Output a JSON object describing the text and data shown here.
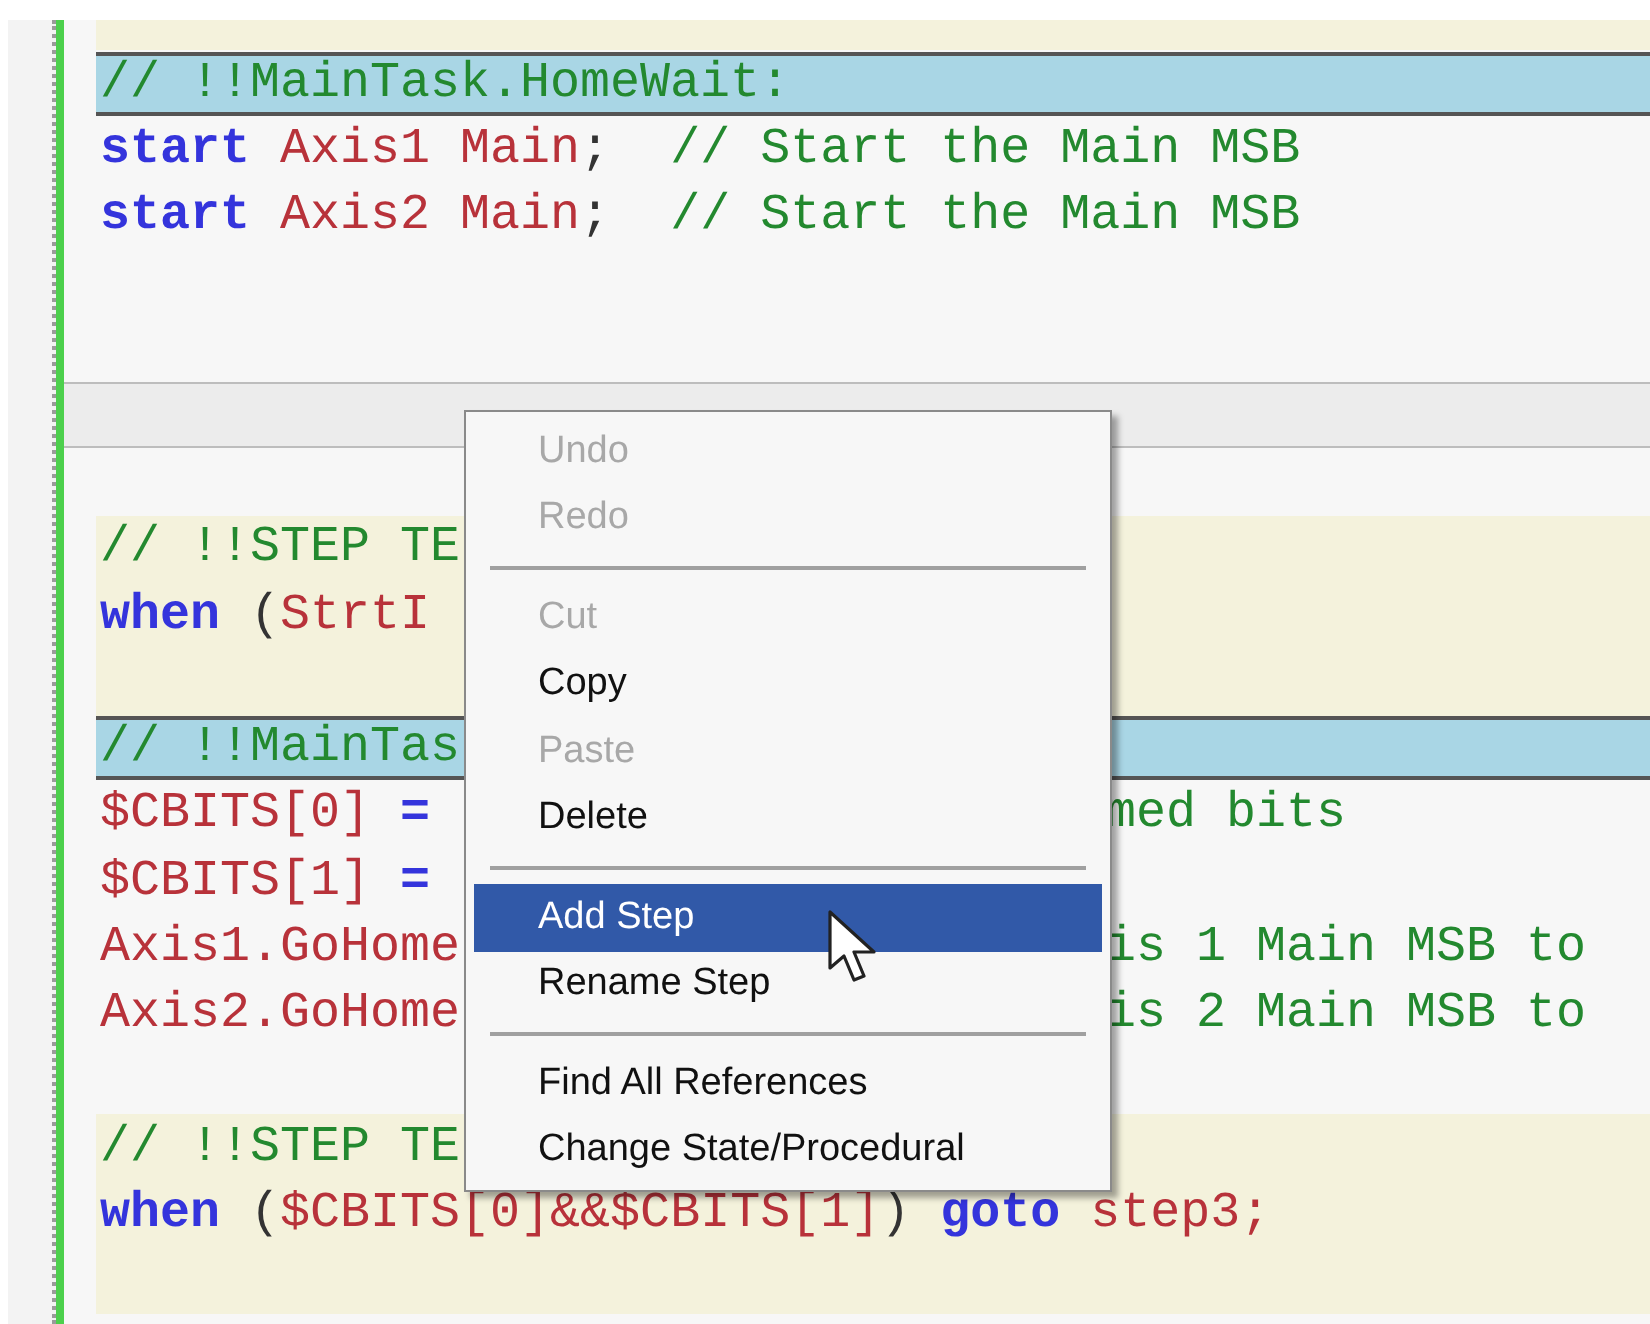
{
  "editor": {
    "lines": [
      {
        "kind": "step"
      },
      {
        "kind": "header",
        "left": [
          {
            "kind": "comment",
            "text": "// !!MainTask.HomeWait:"
          }
        ]
      },
      {
        "kind": "task",
        "left": [
          {
            "kind": "keyword",
            "text": "start"
          },
          {
            "kind": "ident",
            "text": " Axis1 Main"
          },
          {
            "kind": "plain",
            "text": ";"
          },
          {
            "kind": "comment",
            "text": "  // Start the Main MSB"
          }
        ]
      },
      {
        "kind": "task",
        "left": [
          {
            "kind": "keyword",
            "text": "start"
          },
          {
            "kind": "ident",
            "text": " Axis2 Main"
          },
          {
            "kind": "plain",
            "text": ";"
          },
          {
            "kind": "comment",
            "text": "  // Start the Main MSB"
          }
        ]
      },
      {
        "kind": "task"
      },
      {
        "kind": "task"
      },
      {
        "kind": "separator"
      },
      {
        "kind": "task"
      },
      {
        "kind": "step",
        "left": [
          {
            "kind": "comment",
            "text": "// !!STEP TE"
          }
        ]
      },
      {
        "kind": "step",
        "left": [
          {
            "kind": "keyword",
            "text": "when"
          },
          {
            "kind": "plain",
            "text": " ("
          },
          {
            "kind": "ident",
            "text": "StrtI"
          }
        ]
      },
      {
        "kind": "step"
      },
      {
        "kind": "header",
        "left": [
          {
            "kind": "comment",
            "text": "// !!MainTas"
          }
        ]
      },
      {
        "kind": "task",
        "left": [
          {
            "kind": "ident",
            "text": "$CBITS[0]"
          },
          {
            "kind": "keyword",
            "text": " ="
          }
        ],
        "right": [
          {
            "kind": "comment",
            "text": "med bits"
          }
        ]
      },
      {
        "kind": "task",
        "left": [
          {
            "kind": "ident",
            "text": "$CBITS[1]"
          },
          {
            "kind": "keyword",
            "text": " ="
          }
        ]
      },
      {
        "kind": "task",
        "left": [
          {
            "kind": "ident",
            "text": "Axis1.GoHome"
          }
        ],
        "right": [
          {
            "kind": "comment",
            "text": "is 1 Main MSB to"
          }
        ]
      },
      {
        "kind": "task",
        "left": [
          {
            "kind": "ident",
            "text": "Axis2.GoHome"
          }
        ],
        "right": [
          {
            "kind": "comment",
            "text": "is 2 Main MSB to"
          }
        ]
      },
      {
        "kind": "task"
      },
      {
        "kind": "step",
        "left": [
          {
            "kind": "comment",
            "text": "// !!STEP TE"
          }
        ]
      },
      {
        "kind": "step",
        "left": [
          {
            "kind": "keyword",
            "text": "when"
          },
          {
            "kind": "plain",
            "text": " ("
          },
          {
            "kind": "ident",
            "text": "$CBITS[0]&&$CBITS[1]"
          },
          {
            "kind": "plain",
            "text": ")"
          },
          {
            "kind": "keyword",
            "text": " goto"
          },
          {
            "kind": "ident",
            "text": " step3;"
          }
        ]
      },
      {
        "kind": "step"
      }
    ]
  },
  "context_menu": {
    "items": [
      {
        "kind": "item",
        "label": "Undo",
        "disabled": true,
        "selected": false
      },
      {
        "kind": "item",
        "label": "Redo",
        "disabled": true,
        "selected": false
      },
      {
        "kind": "separator"
      },
      {
        "kind": "item",
        "label": "Cut",
        "disabled": true,
        "selected": false
      },
      {
        "kind": "item",
        "label": "Copy",
        "disabled": false,
        "selected": false
      },
      {
        "kind": "item",
        "label": "Paste",
        "disabled": true,
        "selected": false
      },
      {
        "kind": "item",
        "label": "Delete",
        "disabled": false,
        "selected": false
      },
      {
        "kind": "separator"
      },
      {
        "kind": "item",
        "label": "Add Step",
        "disabled": false,
        "selected": true
      },
      {
        "kind": "item",
        "label": "Rename Step",
        "disabled": false,
        "selected": false
      },
      {
        "kind": "separator"
      },
      {
        "kind": "item",
        "label": "Find All References",
        "disabled": false,
        "selected": false
      },
      {
        "kind": "item",
        "label": "Change State/Procedural",
        "disabled": false,
        "selected": false
      }
    ]
  }
}
